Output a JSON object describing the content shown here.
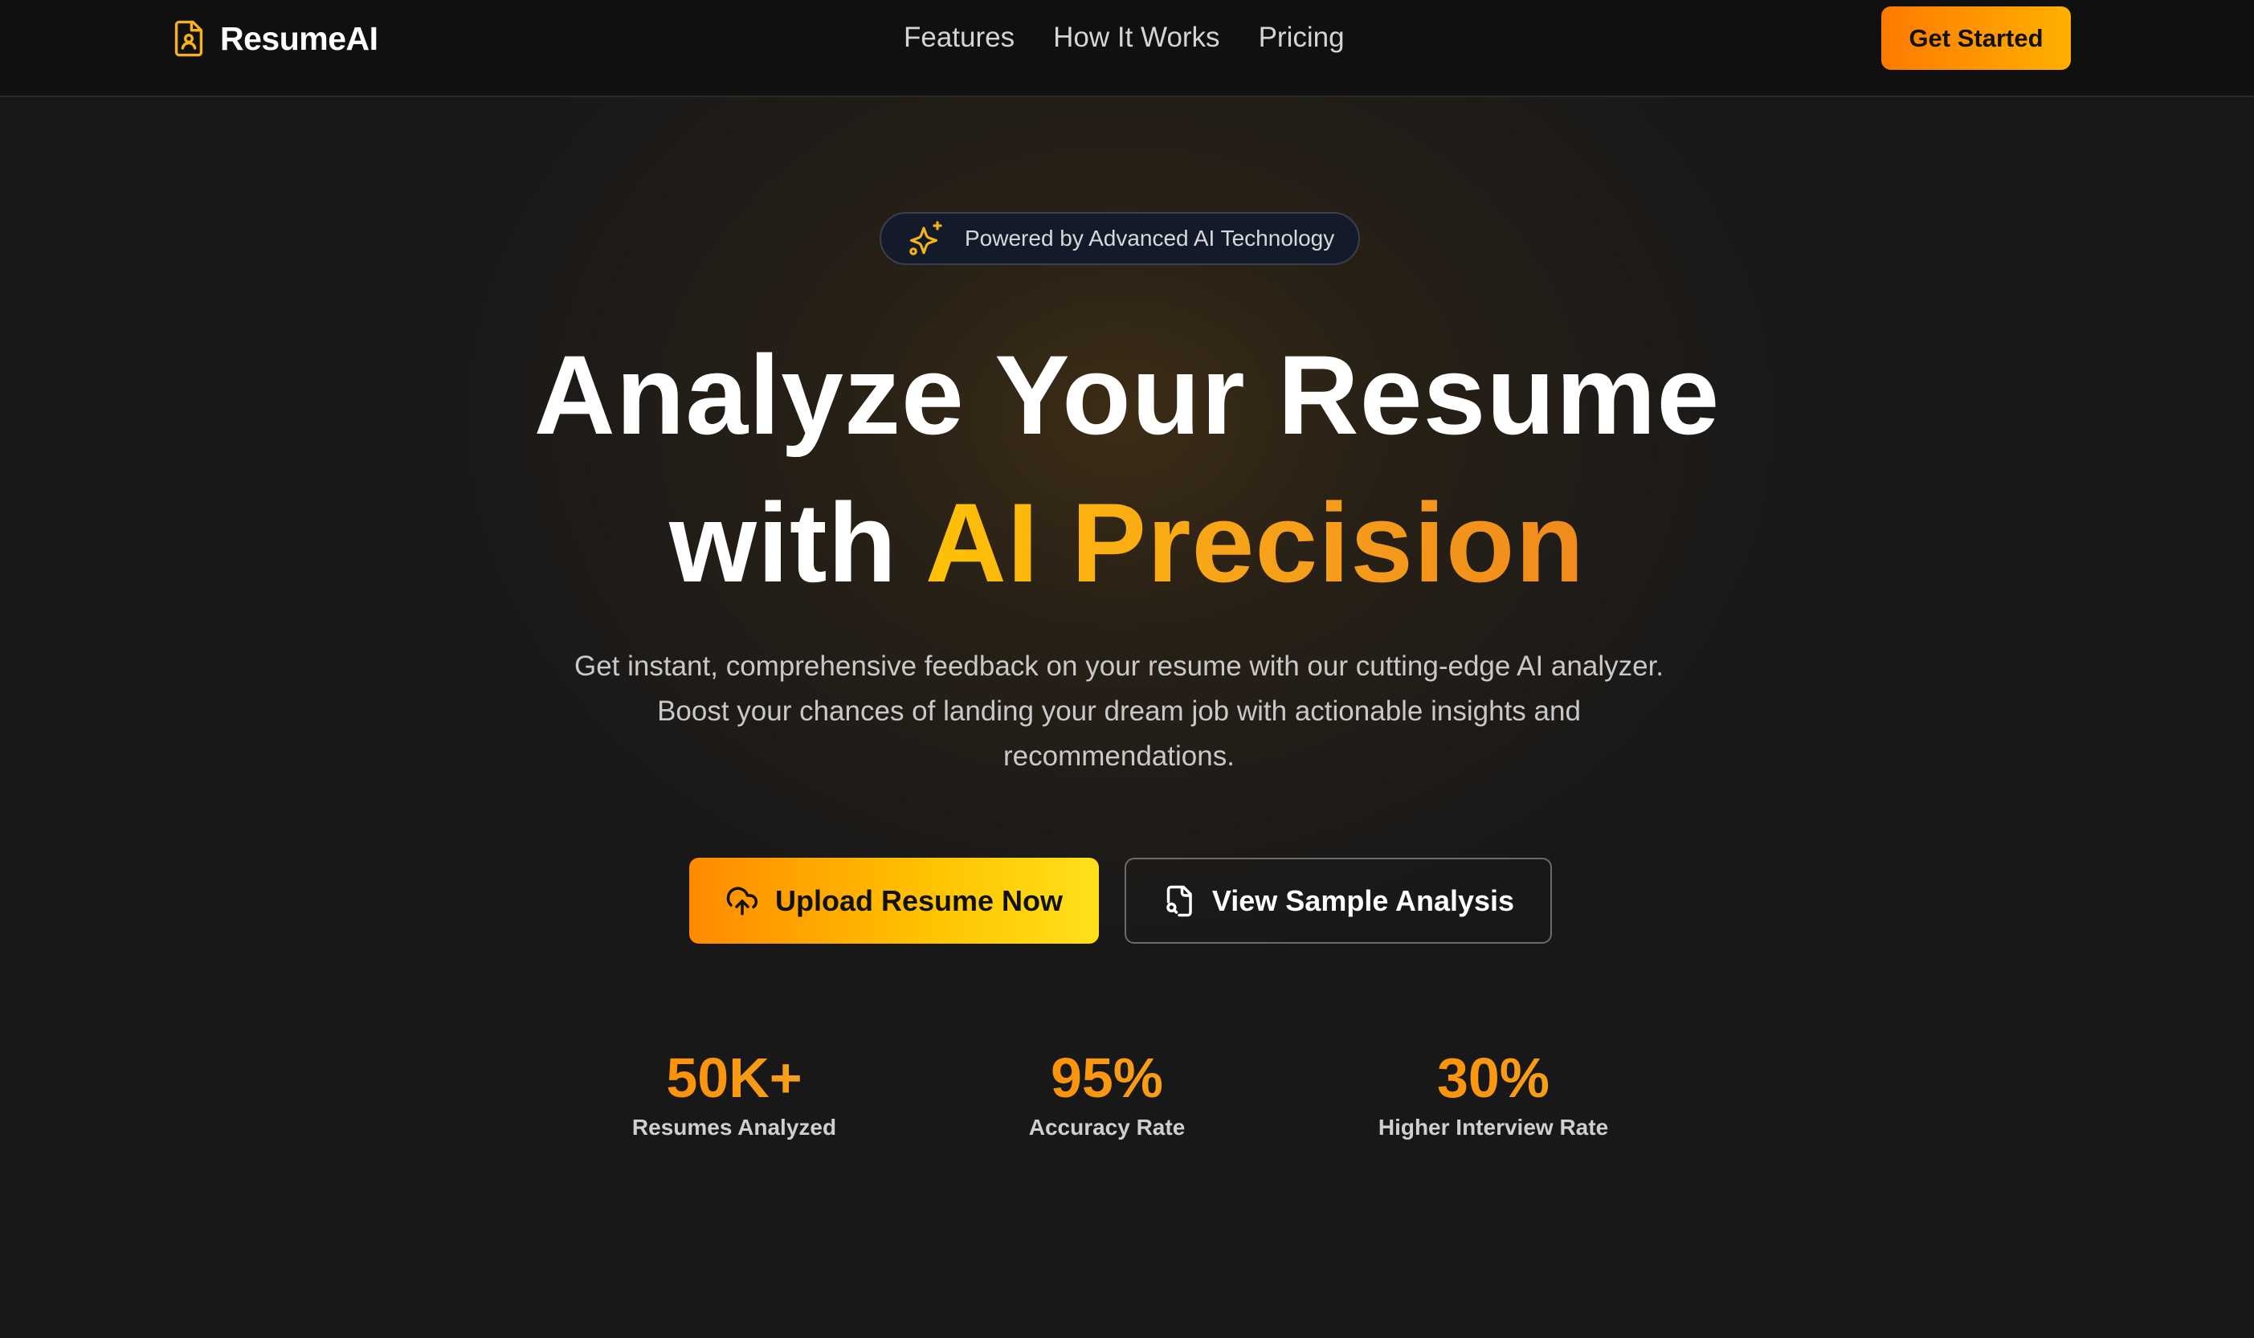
{
  "brand": {
    "name": "ResumeAI",
    "icon": "file-user-icon"
  },
  "nav": {
    "links": [
      {
        "label": "Features"
      },
      {
        "label": "How It Works"
      },
      {
        "label": "Pricing"
      }
    ],
    "cta_label": "Get Started"
  },
  "hero": {
    "badge": {
      "icon": "sparkles-icon",
      "text": "Powered by Advanced AI Technology"
    },
    "headline_line1": "Analyze Your Resume",
    "headline_line2_prefix": "with",
    "headline_line2_accent": "AI Precision",
    "subtitle": "Get instant, comprehensive feedback on your resume with our cutting-edge AI analyzer. Boost your chances of landing your dream job with actionable insights and recommendations.",
    "primary_button": {
      "label": "Upload Resume Now",
      "icon": "cloud-upload-icon"
    },
    "secondary_button": {
      "label": "View Sample Analysis",
      "icon": "file-search-icon"
    }
  },
  "stats": [
    {
      "value": "50K+",
      "label": "Resumes Analyzed"
    },
    {
      "value": "95%",
      "label": "Accuracy Rate"
    },
    {
      "value": "30%",
      "label": "Higher Interview Rate"
    }
  ],
  "colors": {
    "background": "#181818",
    "navbar": "#101010",
    "accent_start": "#ff8a00",
    "accent_end": "#ffc400",
    "text_primary": "#ffffff",
    "text_secondary": "#c9c9c9"
  }
}
